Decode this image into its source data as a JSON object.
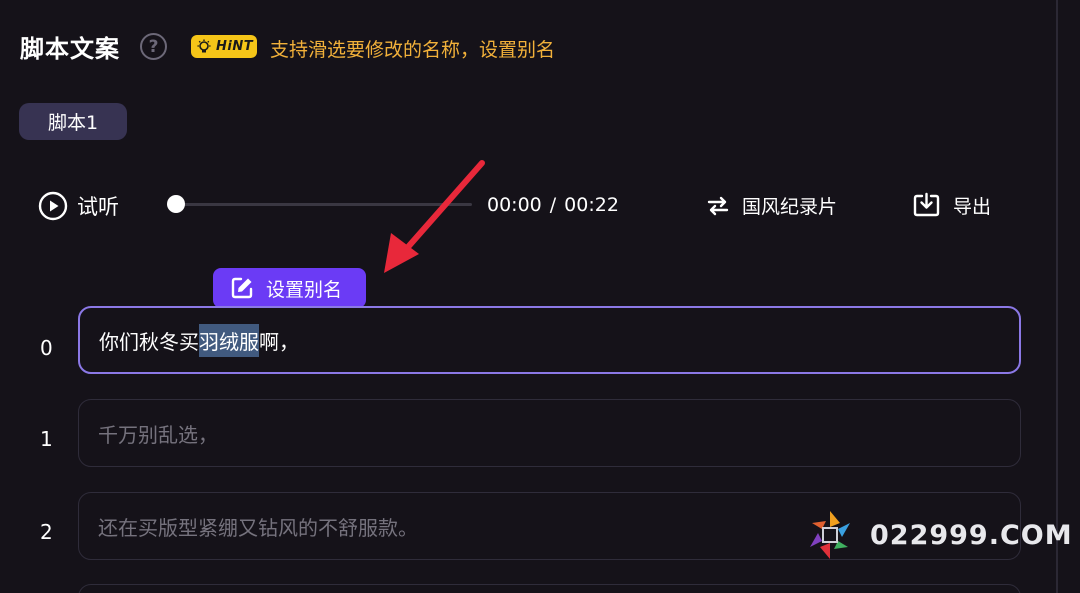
{
  "header": {
    "title": "脚本文案",
    "help_glyph": "?",
    "hint_badge": "HiNT",
    "hint_message": "支持滑选要修改的名称，设置别名"
  },
  "script_tab": {
    "label": "脚本1"
  },
  "player": {
    "play_label": "试听",
    "progress_fraction": 0.0,
    "current_time": "00:00",
    "separator": "/",
    "total_time": "00:22",
    "voice_label": "国风纪录片",
    "export_label": "导出"
  },
  "alias_popup": {
    "label": "设置别名"
  },
  "lines": [
    {
      "index": "0",
      "before": "你们秋冬买",
      "selected": "羽绒服",
      "after": "啊，",
      "state": "active"
    },
    {
      "index": "1",
      "text": "千万别乱选，",
      "state": "inactive"
    },
    {
      "index": "2",
      "text": "还在买版型紧绷又钻风的不舒服款。",
      "state": "inactive"
    }
  ],
  "watermark": {
    "text": "022999.COM"
  },
  "colors": {
    "background": "#151219",
    "accent_purple": "#6b3bf5",
    "active_border": "#8b78e6",
    "hint_yellow": "#f5c518",
    "hint_text": "#f2b13a",
    "selection": "#415a7f",
    "annotation_red": "#e8283a"
  },
  "icons": {
    "help": "question-circle-icon",
    "hint": "lightbulb-icon",
    "play": "play-circle-icon",
    "voice": "swap-arrows-icon",
    "export": "download-tray-icon",
    "alias": "edit-pencil-square-icon",
    "annotation": "red-arrow-icon"
  }
}
